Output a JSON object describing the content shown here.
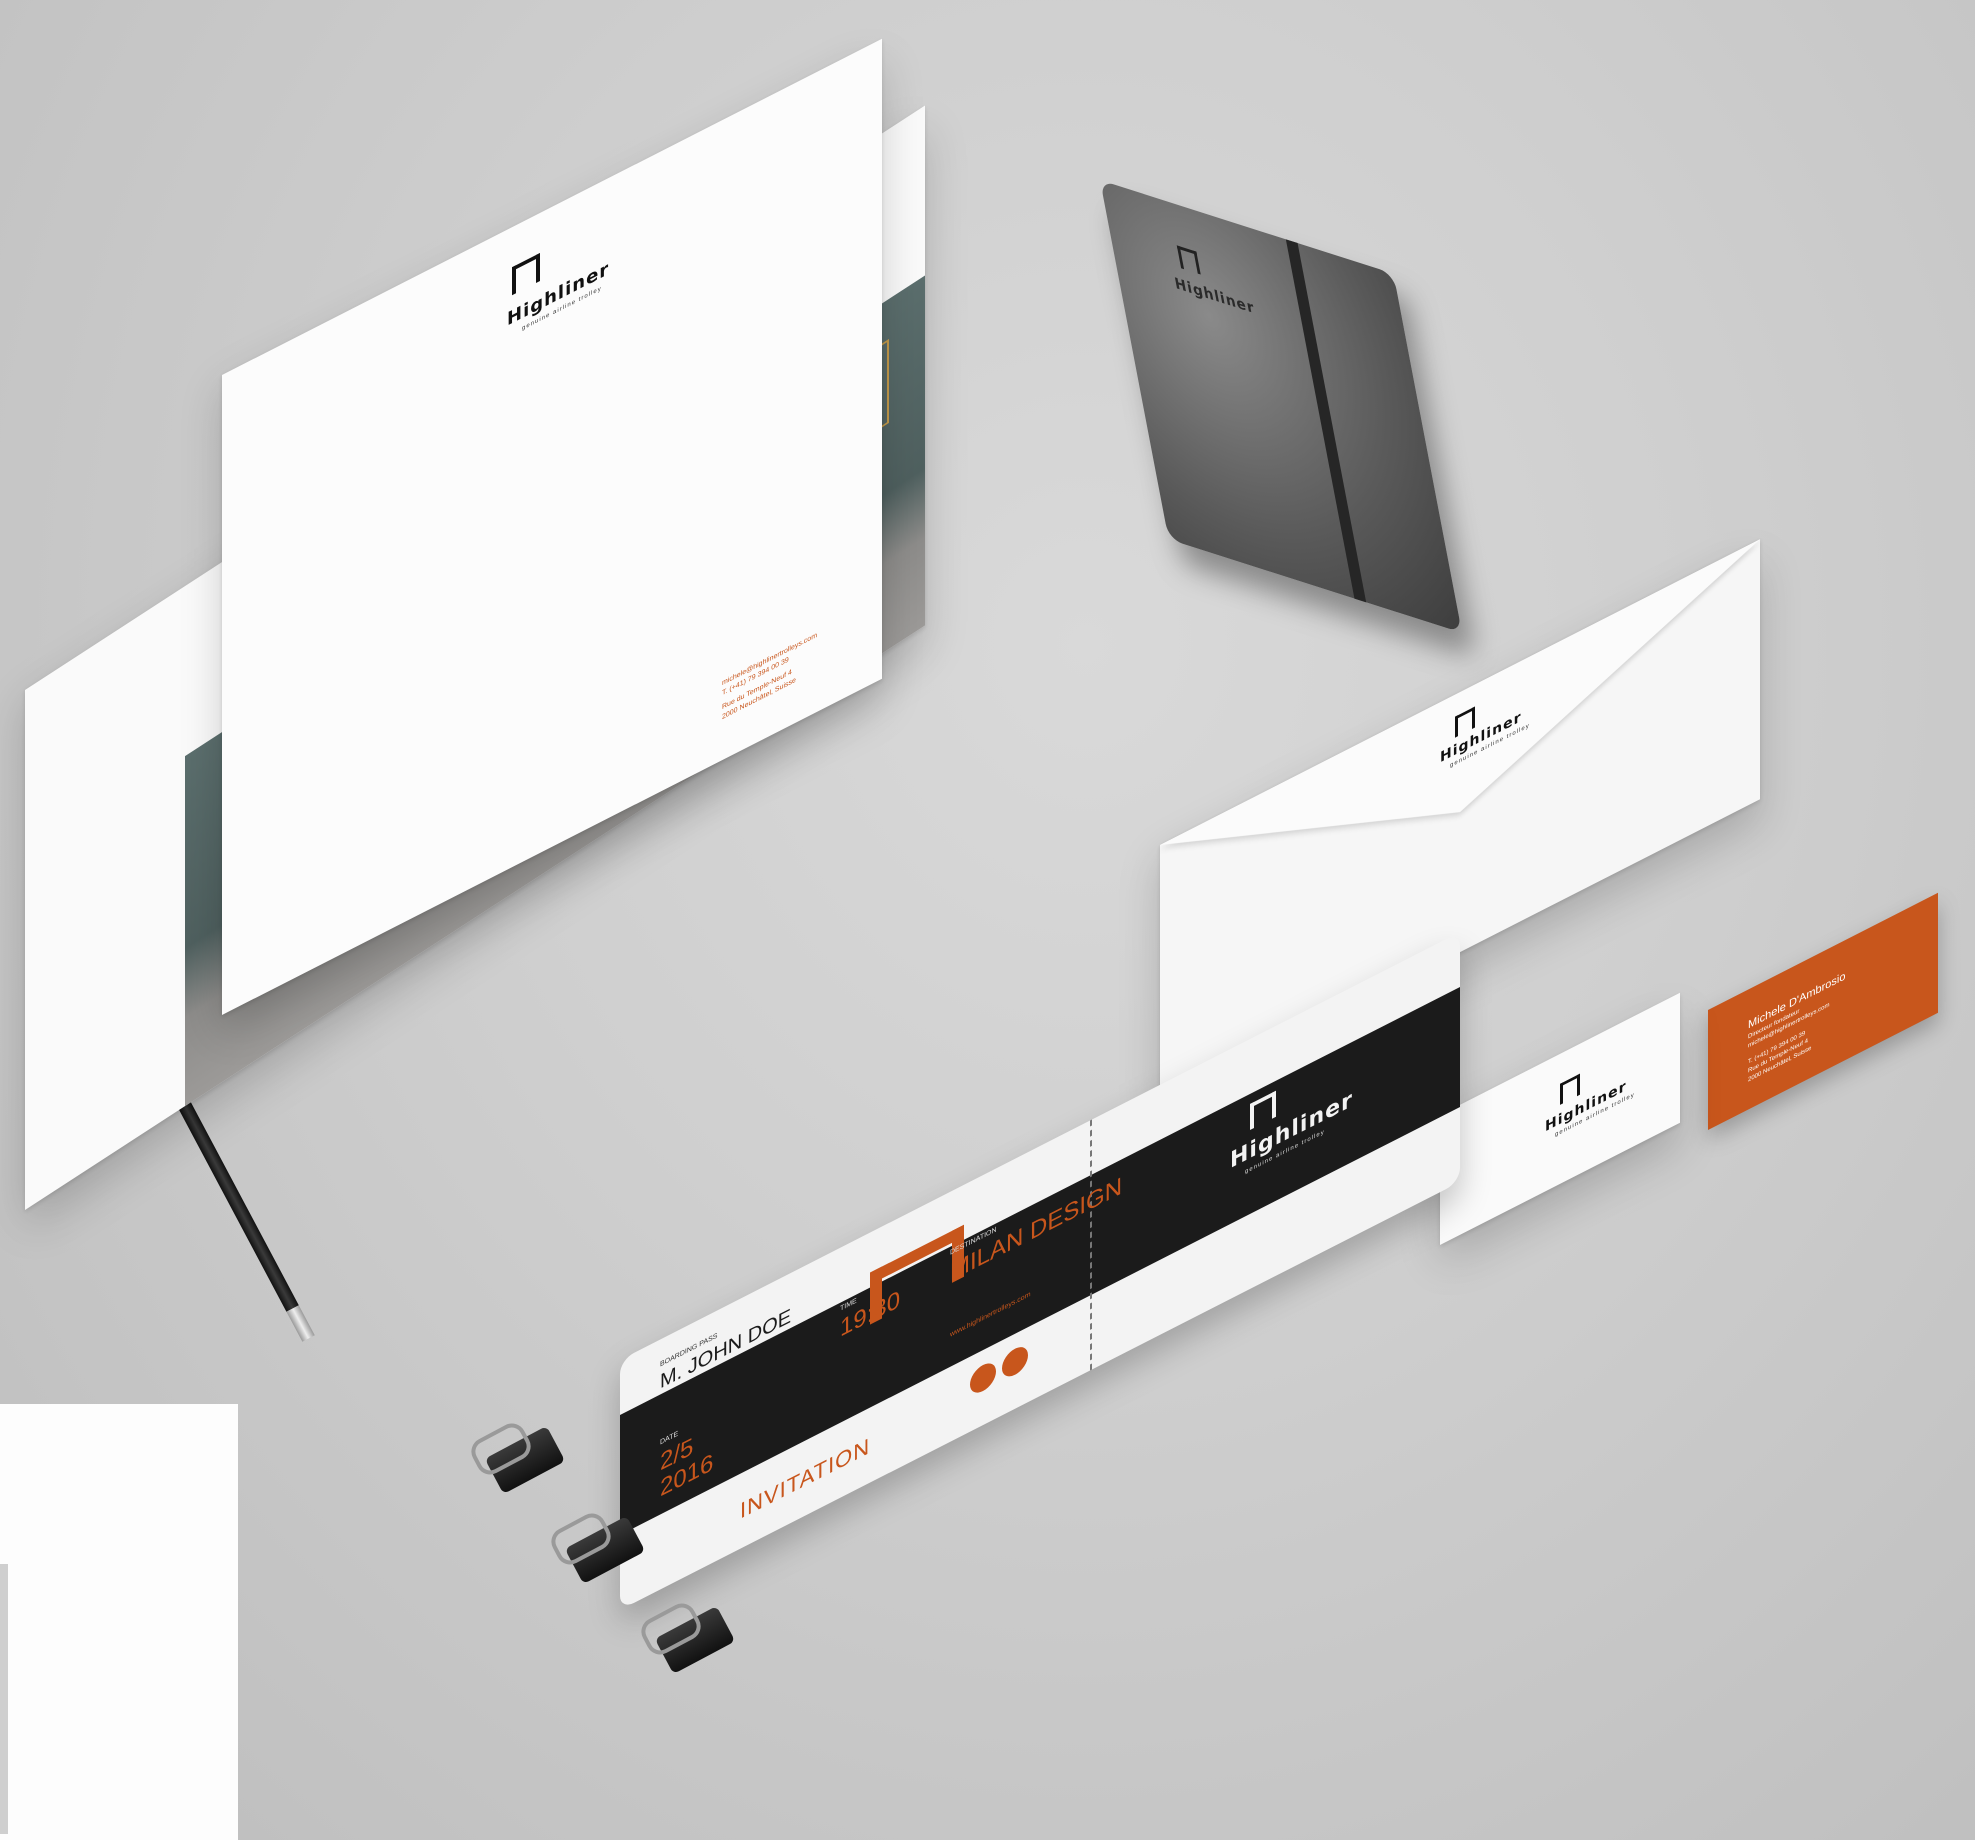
{
  "brand": {
    "name": "Highliner",
    "tagline": "genuine airline trolley",
    "accent_color": "#c8561c",
    "dark_color": "#1b1b1b"
  },
  "letterhead": {
    "email": "michele@highlinertrolleys.com",
    "phone": "T. (+41) 79 394 00 39",
    "address_line1": "Rue du Temple-Neuf 4",
    "address_line2": "2000 Neuchâtel, Suisse"
  },
  "boarding_pass": {
    "pass_label": "BOARDING PASS",
    "passenger": "M. JOHN DOE",
    "time_label": "TIME",
    "time": "19:30",
    "destination_label": "DESTINATION",
    "destination": "MILAN DESIGN",
    "date_label": "DATE",
    "date_line1": "2/5",
    "date_line2": "2016",
    "website": "www.highlinertrolleys.com",
    "footer": "INVITATION"
  },
  "business_card_orange": {
    "name": "Michele D'Ambrosio",
    "title": "Directeur fondateur",
    "email": "michele@highlinertrolleys.com",
    "phone": "T. (+41) 79 394 00 39",
    "address_line1": "Rue du Temple-Neuf 4",
    "address_line2": "2000 Neuchâtel, Suisse"
  },
  "icons": [
    "pencil-icon",
    "binder-clip-icon",
    "notebook-icon",
    "envelope-icon"
  ]
}
